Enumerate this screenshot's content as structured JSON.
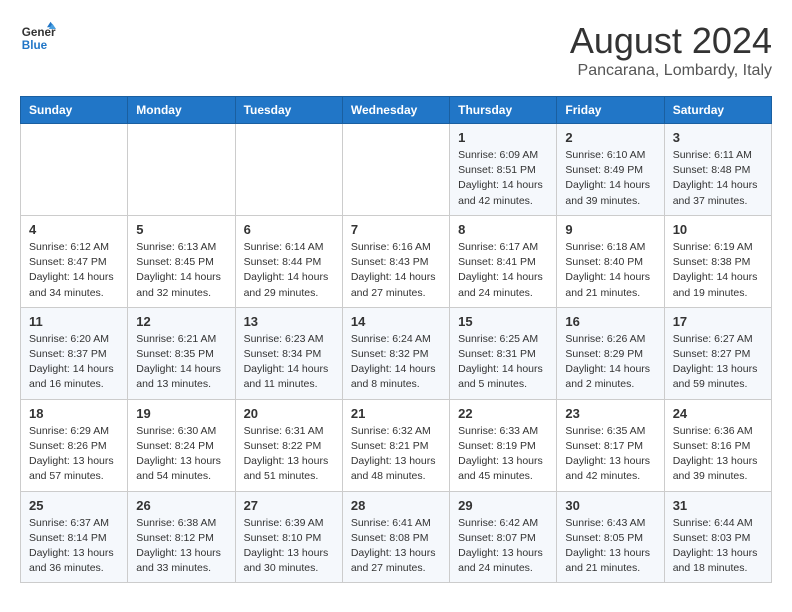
{
  "header": {
    "logo_line1": "General",
    "logo_line2": "Blue",
    "month": "August 2024",
    "location": "Pancarana, Lombardy, Italy"
  },
  "days_of_week": [
    "Sunday",
    "Monday",
    "Tuesday",
    "Wednesday",
    "Thursday",
    "Friday",
    "Saturday"
  ],
  "weeks": [
    [
      {
        "day": "",
        "info": ""
      },
      {
        "day": "",
        "info": ""
      },
      {
        "day": "",
        "info": ""
      },
      {
        "day": "",
        "info": ""
      },
      {
        "day": "1",
        "info": "Sunrise: 6:09 AM\nSunset: 8:51 PM\nDaylight: 14 hours\nand 42 minutes."
      },
      {
        "day": "2",
        "info": "Sunrise: 6:10 AM\nSunset: 8:49 PM\nDaylight: 14 hours\nand 39 minutes."
      },
      {
        "day": "3",
        "info": "Sunrise: 6:11 AM\nSunset: 8:48 PM\nDaylight: 14 hours\nand 37 minutes."
      }
    ],
    [
      {
        "day": "4",
        "info": "Sunrise: 6:12 AM\nSunset: 8:47 PM\nDaylight: 14 hours\nand 34 minutes."
      },
      {
        "day": "5",
        "info": "Sunrise: 6:13 AM\nSunset: 8:45 PM\nDaylight: 14 hours\nand 32 minutes."
      },
      {
        "day": "6",
        "info": "Sunrise: 6:14 AM\nSunset: 8:44 PM\nDaylight: 14 hours\nand 29 minutes."
      },
      {
        "day": "7",
        "info": "Sunrise: 6:16 AM\nSunset: 8:43 PM\nDaylight: 14 hours\nand 27 minutes."
      },
      {
        "day": "8",
        "info": "Sunrise: 6:17 AM\nSunset: 8:41 PM\nDaylight: 14 hours\nand 24 minutes."
      },
      {
        "day": "9",
        "info": "Sunrise: 6:18 AM\nSunset: 8:40 PM\nDaylight: 14 hours\nand 21 minutes."
      },
      {
        "day": "10",
        "info": "Sunrise: 6:19 AM\nSunset: 8:38 PM\nDaylight: 14 hours\nand 19 minutes."
      }
    ],
    [
      {
        "day": "11",
        "info": "Sunrise: 6:20 AM\nSunset: 8:37 PM\nDaylight: 14 hours\nand 16 minutes."
      },
      {
        "day": "12",
        "info": "Sunrise: 6:21 AM\nSunset: 8:35 PM\nDaylight: 14 hours\nand 13 minutes."
      },
      {
        "day": "13",
        "info": "Sunrise: 6:23 AM\nSunset: 8:34 PM\nDaylight: 14 hours\nand 11 minutes."
      },
      {
        "day": "14",
        "info": "Sunrise: 6:24 AM\nSunset: 8:32 PM\nDaylight: 14 hours\nand 8 minutes."
      },
      {
        "day": "15",
        "info": "Sunrise: 6:25 AM\nSunset: 8:31 PM\nDaylight: 14 hours\nand 5 minutes."
      },
      {
        "day": "16",
        "info": "Sunrise: 6:26 AM\nSunset: 8:29 PM\nDaylight: 14 hours\nand 2 minutes."
      },
      {
        "day": "17",
        "info": "Sunrise: 6:27 AM\nSunset: 8:27 PM\nDaylight: 13 hours\nand 59 minutes."
      }
    ],
    [
      {
        "day": "18",
        "info": "Sunrise: 6:29 AM\nSunset: 8:26 PM\nDaylight: 13 hours\nand 57 minutes."
      },
      {
        "day": "19",
        "info": "Sunrise: 6:30 AM\nSunset: 8:24 PM\nDaylight: 13 hours\nand 54 minutes."
      },
      {
        "day": "20",
        "info": "Sunrise: 6:31 AM\nSunset: 8:22 PM\nDaylight: 13 hours\nand 51 minutes."
      },
      {
        "day": "21",
        "info": "Sunrise: 6:32 AM\nSunset: 8:21 PM\nDaylight: 13 hours\nand 48 minutes."
      },
      {
        "day": "22",
        "info": "Sunrise: 6:33 AM\nSunset: 8:19 PM\nDaylight: 13 hours\nand 45 minutes."
      },
      {
        "day": "23",
        "info": "Sunrise: 6:35 AM\nSunset: 8:17 PM\nDaylight: 13 hours\nand 42 minutes."
      },
      {
        "day": "24",
        "info": "Sunrise: 6:36 AM\nSunset: 8:16 PM\nDaylight: 13 hours\nand 39 minutes."
      }
    ],
    [
      {
        "day": "25",
        "info": "Sunrise: 6:37 AM\nSunset: 8:14 PM\nDaylight: 13 hours\nand 36 minutes."
      },
      {
        "day": "26",
        "info": "Sunrise: 6:38 AM\nSunset: 8:12 PM\nDaylight: 13 hours\nand 33 minutes."
      },
      {
        "day": "27",
        "info": "Sunrise: 6:39 AM\nSunset: 8:10 PM\nDaylight: 13 hours\nand 30 minutes."
      },
      {
        "day": "28",
        "info": "Sunrise: 6:41 AM\nSunset: 8:08 PM\nDaylight: 13 hours\nand 27 minutes."
      },
      {
        "day": "29",
        "info": "Sunrise: 6:42 AM\nSunset: 8:07 PM\nDaylight: 13 hours\nand 24 minutes."
      },
      {
        "day": "30",
        "info": "Sunrise: 6:43 AM\nSunset: 8:05 PM\nDaylight: 13 hours\nand 21 minutes."
      },
      {
        "day": "31",
        "info": "Sunrise: 6:44 AM\nSunset: 8:03 PM\nDaylight: 13 hours\nand 18 minutes."
      }
    ]
  ]
}
